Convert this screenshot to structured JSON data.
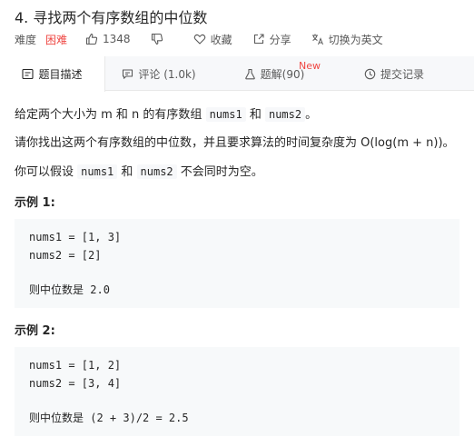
{
  "problem": {
    "title": "4. 寻找两个有序数组的中位数",
    "difficulty_label": "难度",
    "difficulty": "困难",
    "likes": "1348",
    "favorite_label": "收藏",
    "share_label": "分享",
    "translate_label": "切换为英文"
  },
  "tabs": [
    {
      "label": "题目描述"
    },
    {
      "label": "评论 (1.0k)"
    },
    {
      "label": "题解(90)",
      "badge": "New"
    },
    {
      "label": "提交记录"
    }
  ],
  "description": {
    "p1_a": "给定两个大小为 m 和 n 的有序数组 ",
    "p1_code1": "nums1",
    "p1_b": " 和 ",
    "p1_code2": "nums2",
    "p1_c": "。",
    "p2": "请你找出这两个有序数组的中位数，并且要求算法的时间复杂度为 O(log(m + n))。",
    "p3_a": "你可以假设 ",
    "p3_code1": "nums1",
    "p3_b": " 和 ",
    "p3_code2": "nums2",
    "p3_c": " 不会同时为空。"
  },
  "examples": [
    {
      "title": "示例 1:",
      "line1": "nums1 = [1, 3]",
      "line2": "nums2 = [2]",
      "result_label": "则中位数是",
      "result_value": " 2.0"
    },
    {
      "title": "示例 2:",
      "line1": "nums1 = [1, 2]",
      "line2": "nums2 = [3, 4]",
      "result_label": "则中位数是",
      "result_value": " (2 + 3)/2 = 2.5"
    }
  ],
  "colors": {
    "difficulty_hard": "#ef4743",
    "tab_bar_bg": "#f7f8fa",
    "code_bg": "#f7f9fa"
  }
}
